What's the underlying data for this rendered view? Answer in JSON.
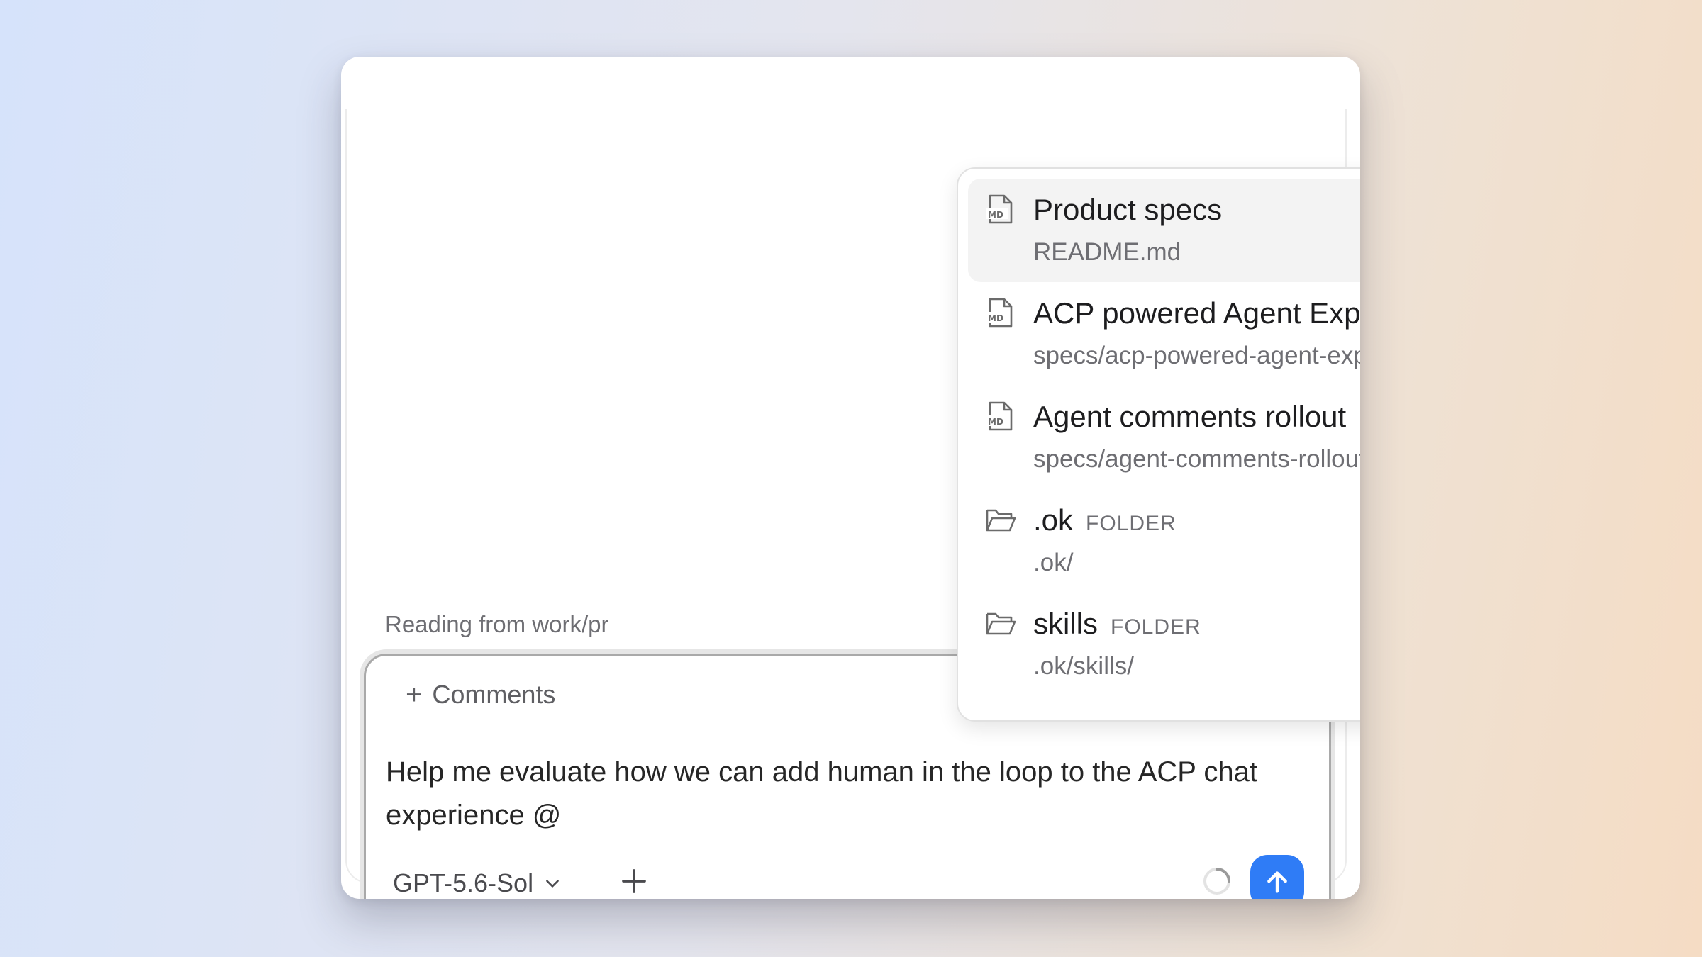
{
  "status_text": "Reading from work/pr",
  "composer": {
    "comments_label": "Comments",
    "prompt_text": "Help me evaluate how we can add human in the loop to the ACP chat experience @",
    "model_label": "GPT-5.6-Sol"
  },
  "mention_popover": {
    "items": [
      {
        "title": "Product specs",
        "path": "README.md",
        "type": "file",
        "icon": "markdown-file-icon",
        "active": true
      },
      {
        "title": "ACP powered Agent Experiences",
        "path": "specs/acp-powered-agent-experiences.md",
        "type": "file",
        "icon": "markdown-file-icon"
      },
      {
        "title": "Agent comments rollout",
        "path": "specs/agent-comments-rollout.md",
        "type": "file",
        "icon": "markdown-file-icon"
      },
      {
        "title": ".ok",
        "badge": "FOLDER",
        "path": ".ok/",
        "type": "folder",
        "icon": "folder-icon"
      },
      {
        "title": "skills",
        "badge": "FOLDER",
        "path": ".ok/skills/",
        "type": "folder",
        "icon": "folder-icon"
      }
    ]
  },
  "colors": {
    "accent": "#2f7cf6",
    "active_item_bg": "#f3f3f3",
    "secondary_text": "#6e6e73"
  }
}
